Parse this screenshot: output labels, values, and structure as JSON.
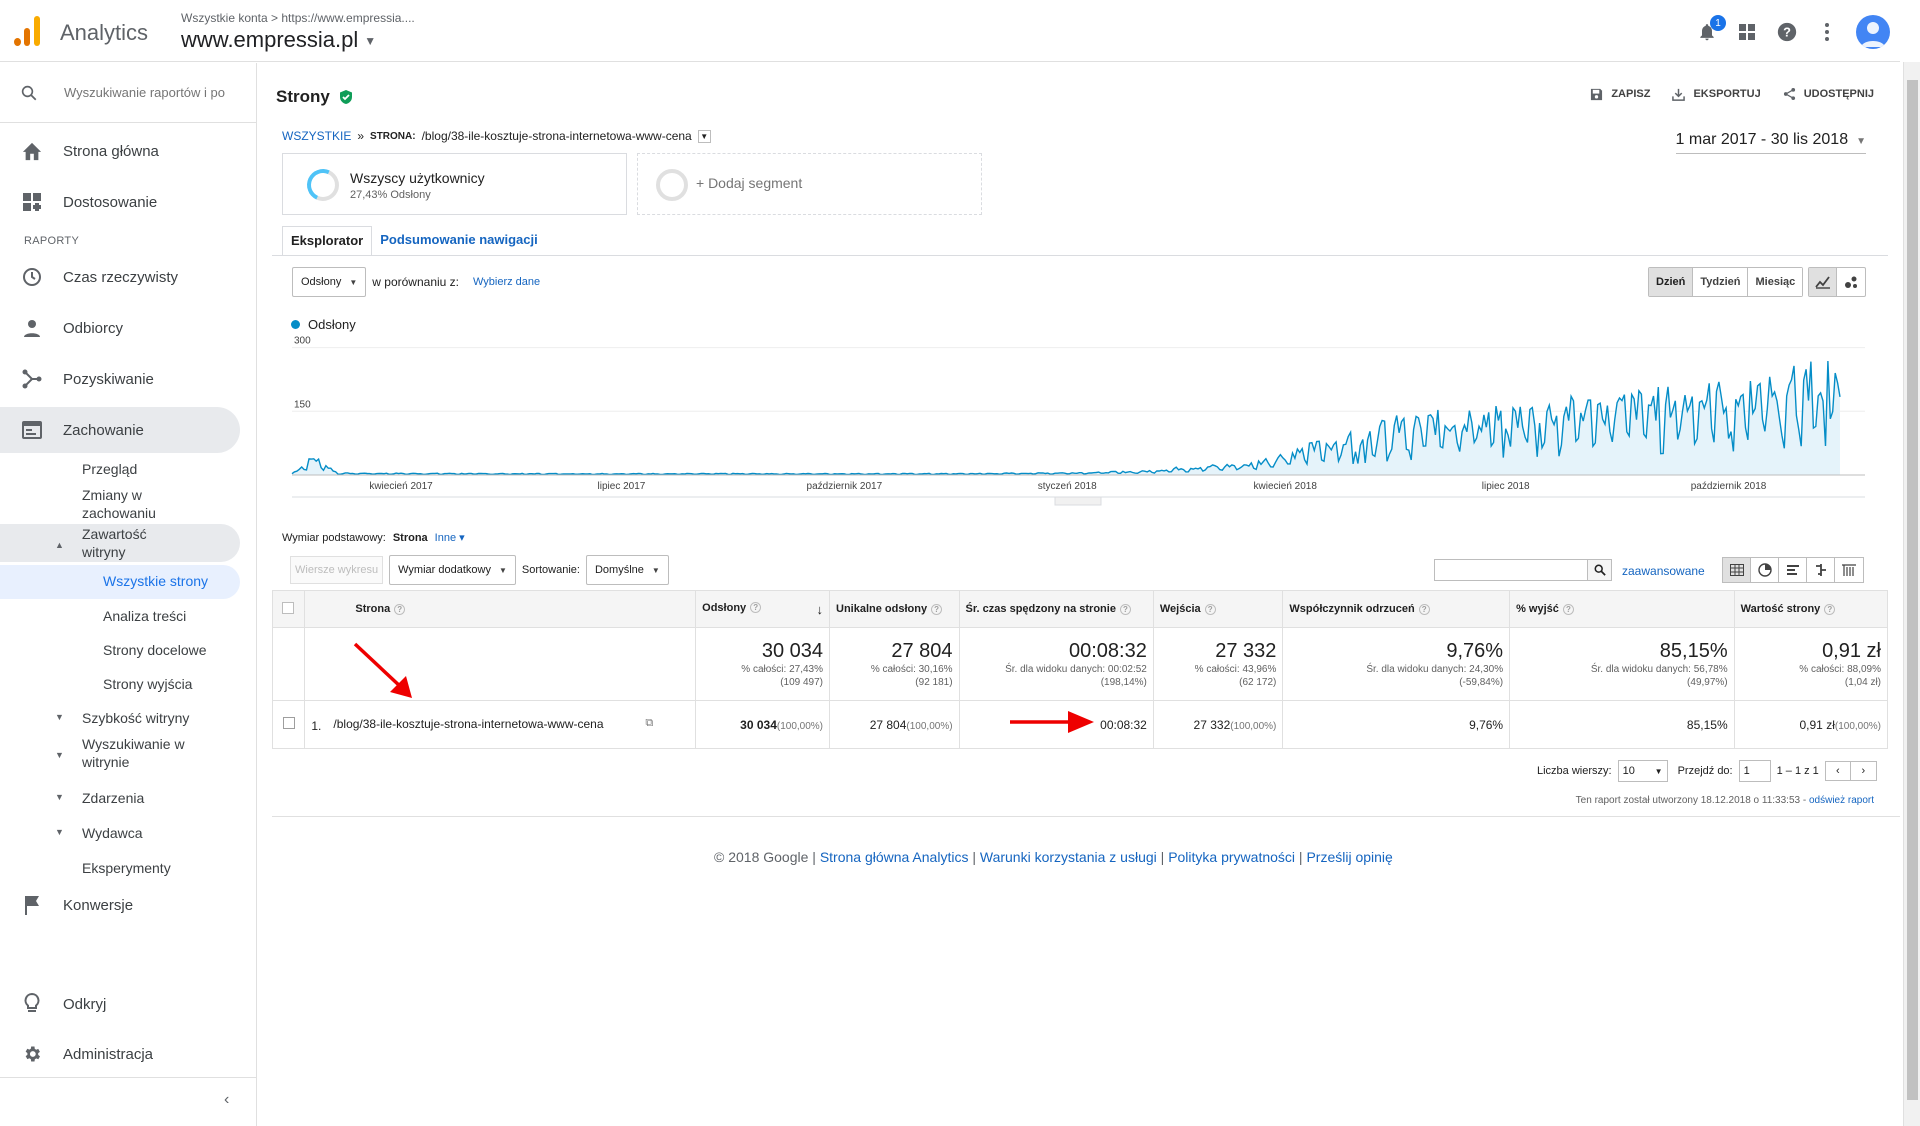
{
  "header": {
    "app_name": "Analytics",
    "breadcrumb": "Wszystkie konta > https://www.empressia....",
    "account": "www.empressia.pl",
    "notifications": "1",
    "brand_colors": {
      "orange": "#f9ab00",
      "dark_orange": "#e37400",
      "blue": "#1a73e8"
    }
  },
  "sidebar": {
    "search_placeholder": "Wyszukiwanie raportów i po",
    "home": "Strona główna",
    "customization": "Dostosowanie",
    "reports_label": "RAPORTY",
    "realtime": "Czas rzeczywisty",
    "audience": "Odbiorcy",
    "acquisition": "Pozyskiwanie",
    "behavior": "Zachowanie",
    "overview": "Przegląd",
    "behavior_flow": "Zmiany w zachowaniu",
    "site_content": "Zawartość witryny",
    "all_pages": "Wszystkie strony",
    "content_drilldown": "Analiza treści",
    "landing_pages": "Strony docelowe",
    "exit_pages": "Strony wyjścia",
    "site_speed": "Szybkość witryny",
    "site_search": "Wyszukiwanie w witrynie",
    "events": "Zdarzenia",
    "publisher": "Wydawca",
    "experiments": "Eksperymenty",
    "conversions": "Konwersje",
    "discover": "Odkryj",
    "admin": "Administracja"
  },
  "page": {
    "title": "Strony",
    "save": "ZAPISZ",
    "export": "EKSPORTUJ",
    "share": "UDOSTĘPNIJ",
    "crumb_all": "WSZYSTKIE",
    "crumb_sep": "»",
    "crumb_dim": "STRONA:",
    "crumb_value": "/blog/38-ile-kosztuje-strona-internetowa-www-cena",
    "date_range": "1 mar 2017 - 30 lis 2018"
  },
  "segments": {
    "seg1_title": "Wszyscy użytkownicy",
    "seg1_sub": "27,43% Odsłony",
    "add_segment": "+ Dodaj segment"
  },
  "tabs": {
    "explorer": "Eksplorator",
    "nav_summary": "Podsumowanie nawigacji"
  },
  "controls": {
    "metric": "Odsłony",
    "compare_label": "w porównaniu z:",
    "choose_metric": "Wybierz dane",
    "day": "Dzień",
    "week": "Tydzień",
    "month": "Miesiąc"
  },
  "chart_data": {
    "type": "area",
    "series": [
      {
        "name": "Odsłony",
        "color": "#058dc7"
      }
    ],
    "y_ticks": [
      "300",
      "150"
    ],
    "ylim": [
      0,
      300
    ],
    "x_tick_labels": [
      "kwiecień 2017",
      "lipiec 2017",
      "październik 2017",
      "styczeń 2018",
      "kwiecień 2018",
      "lipiec 2018",
      "październik 2018"
    ],
    "x_range": [
      "2017-03-01",
      "2018-11-30"
    ],
    "grid": true,
    "trend": [
      [
        "2017-03-01",
        3
      ],
      [
        "2017-03-10",
        40
      ],
      [
        "2017-03-20",
        4
      ],
      [
        "2017-06-01",
        3
      ],
      [
        "2017-12-01",
        3
      ],
      [
        "2018-01-15",
        5
      ],
      [
        "2018-02-15",
        8
      ],
      [
        "2018-03-01",
        15
      ],
      [
        "2018-04-01",
        25
      ],
      [
        "2018-05-01",
        70
      ],
      [
        "2018-06-01",
        115
      ],
      [
        "2018-07-01",
        130
      ],
      [
        "2018-08-01",
        145
      ],
      [
        "2018-09-01",
        160
      ],
      [
        "2018-10-01",
        175
      ],
      [
        "2018-11-01",
        195
      ],
      [
        "2018-11-20",
        240
      ],
      [
        "2018-11-30",
        210
      ]
    ]
  },
  "table_controls": {
    "primary_dim_label": "Wymiar podstawowy:",
    "primary_dim": "Strona",
    "other": "Inne",
    "plot_rows": "Wiersze wykresu",
    "secondary_dim": "Wymiar dodatkowy",
    "sort_label": "Sortowanie:",
    "sort_value": "Domyślne",
    "advanced": "zaawansowane"
  },
  "table": {
    "headers": [
      "Strona",
      "Odsłony",
      "Unikalne odsłony",
      "Śr. czas spędzony na stronie",
      "Wejścia",
      "Współczynnik odrzuceń",
      "% wyjść",
      "Wartość strony"
    ],
    "totals": [
      {
        "main": "30 034",
        "sub1": "% całości: 27,43%",
        "sub2": "(109 497)"
      },
      {
        "main": "27 804",
        "sub1": "% całości: 30,16%",
        "sub2": "(92 181)"
      },
      {
        "main": "00:08:32",
        "sub1": "Śr. dla widoku danych: 00:02:52",
        "sub2": "(198,14%)"
      },
      {
        "main": "27 332",
        "sub1": "% całości: 43,96%",
        "sub2": "(62 172)"
      },
      {
        "main": "9,76%",
        "sub1": "Śr. dla widoku danych: 24,30%",
        "sub2": "(-59,84%)"
      },
      {
        "main": "85,15%",
        "sub1": "Śr. dla widoku danych: 56,78%",
        "sub2": "(49,97%)"
      },
      {
        "main": "0,91 zł",
        "sub1": "% całości: 88,09%",
        "sub2": "(1,04 zł)"
      }
    ],
    "row": {
      "index": "1.",
      "page": "/blog/38-ile-kosztuje-strona-internetowa-www-cena",
      "pageviews": "30 034",
      "pageviews_pct": "(100,00%)",
      "unique": "27 804",
      "unique_pct": "(100,00%)",
      "avg_time": "00:08:32",
      "entrances": "27 332",
      "entrances_pct": "(100,00%)",
      "bounce": "9,76%",
      "exit": "85,15%",
      "value": "0,91 zł",
      "value_pct": "(100,00%)"
    }
  },
  "pager": {
    "rows_label": "Liczba wierszy:",
    "rows_value": "10",
    "goto_label": "Przejdź do:",
    "goto_value": "1",
    "range": "1 – 1 z 1"
  },
  "report_note": {
    "text": "Ten raport został utworzony 18.12.2018 o 11:33:53 - ",
    "refresh": "odśwież raport"
  },
  "footer": {
    "copyright": "© 2018 Google | ",
    "link1": "Strona główna Analytics",
    "sep": " | ",
    "link2": "Warunki korzystania z usługi",
    "link3": "Polityka prywatności",
    "link4": "Prześlij opinię"
  }
}
